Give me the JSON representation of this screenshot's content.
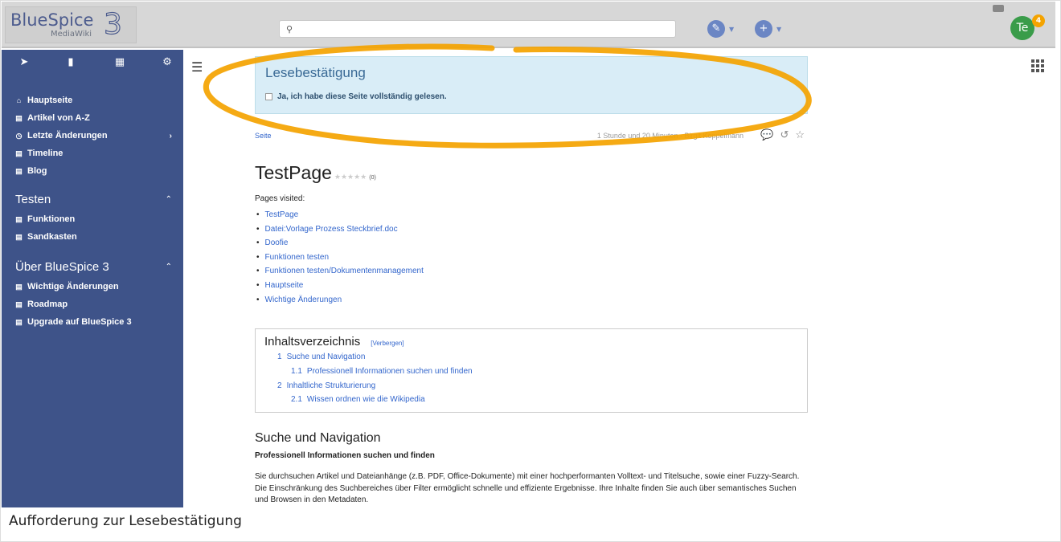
{
  "logo": {
    "main": "BlueSpice",
    "sub": "MediaWiki",
    "version": "3"
  },
  "search": {
    "placeholder": ""
  },
  "user": {
    "initials": "Te",
    "notifications": "4"
  },
  "sidebar": {
    "main_items": [
      {
        "label": "Hauptseite",
        "icon": "home-icon"
      },
      {
        "label": "Artikel von A-Z",
        "icon": "document-icon"
      },
      {
        "label": "Letzte Änderungen",
        "icon": "clock-icon",
        "has_chevron": true
      },
      {
        "label": "Timeline",
        "icon": "document-icon"
      },
      {
        "label": "Blog",
        "icon": "document-icon"
      }
    ],
    "sections": [
      {
        "title": "Testen",
        "items": [
          "Funktionen",
          "Sandkasten"
        ]
      },
      {
        "title": "Über BlueSpice 3",
        "items": [
          "Wichtige Änderungen",
          "Roadmap",
          "Upgrade auf BlueSpice 3"
        ]
      }
    ]
  },
  "read_confirmation": {
    "title": "Lesebestätigung",
    "checkbox_label": "Ja, ich habe diese Seite vollständig gelesen."
  },
  "meta": {
    "tab": "Seite",
    "last_edit": "1 Stunde und 20 Minuten - Birgit Koppelmann"
  },
  "page": {
    "title": "TestPage",
    "rating_stars": "★★★★★",
    "rating_count": "(0)",
    "visited_label": "Pages visited:",
    "visited": [
      "TestPage",
      "Datei:Vorlage Prozess Steckbrief.doc",
      "Doofie",
      "Funktionen testen",
      "Funktionen testen/Dokumentenmanagement",
      "Hauptseite",
      "Wichtige Änderungen"
    ]
  },
  "toc": {
    "title": "Inhaltsverzeichnis",
    "hide": "[Verbergen]",
    "items": [
      {
        "num": "1",
        "label": "Suche und Navigation"
      },
      {
        "num": "1.1",
        "label": "Professionell Informationen suchen und finden"
      },
      {
        "num": "2",
        "label": "Inhaltliche Strukturierung"
      },
      {
        "num": "2.1",
        "label": "Wissen ordnen wie die Wikipedia"
      }
    ]
  },
  "section": {
    "heading": "Suche und Navigation",
    "subheading": "Professionell Informationen suchen und finden",
    "paragraph": "Sie durchsuchen Artikel und Dateianhänge (z.B. PDF, Office-Dokumente) mit einer hochperformanten Volltext- und Titelsuche, sowie einer Fuzzy-Search. Die Einschränkung des Suchbereiches über Filter ermöglicht schnelle und effiziente Ergebnisse. Ihre Inhalte finden Sie auch über semantisches Suchen und Browsen in den Metadaten."
  },
  "caption": "Aufforderung zur Lesebestätigung",
  "colors": {
    "sidebar": "#3e5389",
    "accent": "#f4a300",
    "link": "#3366cc",
    "notice_bg": "#d9edf7"
  }
}
